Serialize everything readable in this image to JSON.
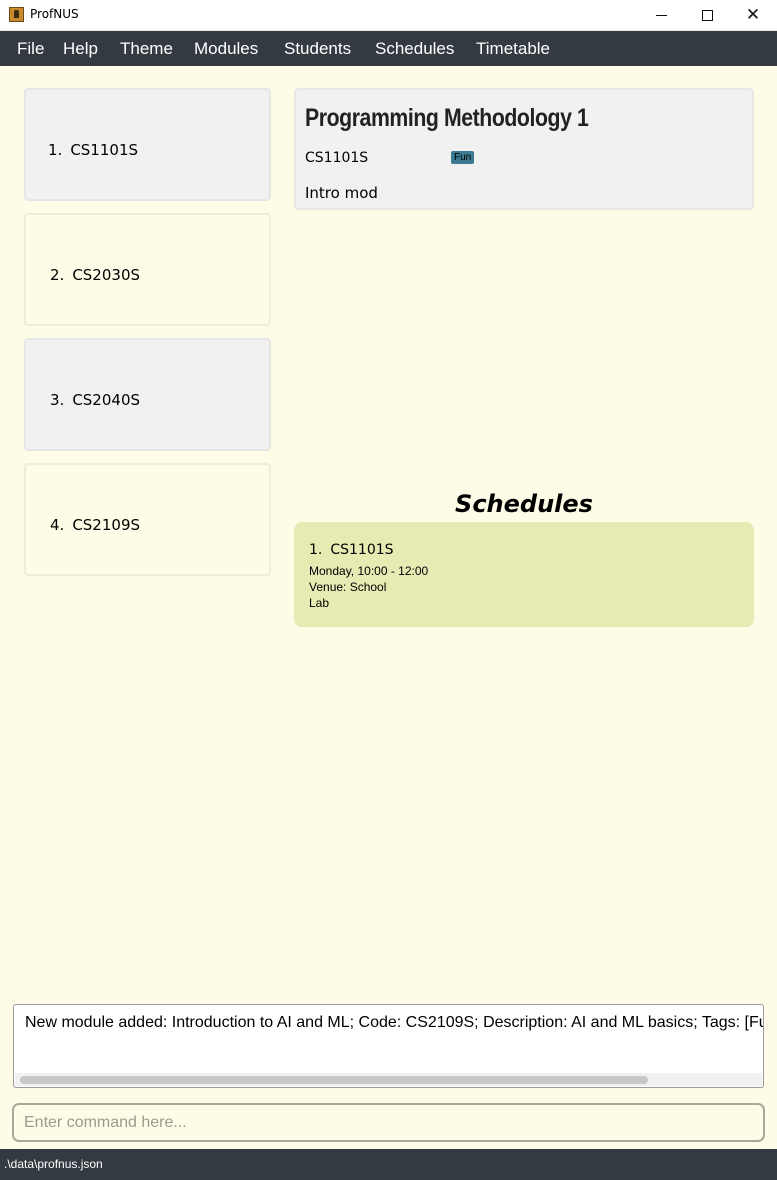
{
  "window": {
    "title": "ProfNUS",
    "close_glyph": "✕"
  },
  "menu": {
    "items": [
      "File",
      "Help",
      "Theme",
      "Modules",
      "Students",
      "Schedules",
      "Timetable"
    ]
  },
  "modules": {
    "items": [
      {
        "index": "1.",
        "code": "CS1101S"
      },
      {
        "index": "2.",
        "code": "CS2030S"
      },
      {
        "index": "3.",
        "code": "CS2040S"
      },
      {
        "index": "4.",
        "code": "CS2109S"
      }
    ]
  },
  "detail": {
    "title": "Programming Methodology 1",
    "code": "CS1101S",
    "tag": "Fun",
    "description": "Intro mod"
  },
  "schedules": {
    "heading": "Schedules",
    "items": [
      {
        "index": "1.",
        "code": "CS1101S",
        "time": "Monday, 10:00 - 12:00",
        "venue": "Venue: School",
        "type": "Lab"
      }
    ]
  },
  "result": {
    "text": "New module added: Introduction to AI and ML; Code: CS2109S; Description: AI and ML basics; Tags: [Fun]"
  },
  "command": {
    "placeholder": "Enter command here...",
    "value": ""
  },
  "status": {
    "path": ".\\data\\profnus.json"
  },
  "colors": {
    "background": "#fefce6",
    "menu_bar": "#343a41",
    "tag": "#3c7a91",
    "schedule_card": "#e6eab3"
  }
}
